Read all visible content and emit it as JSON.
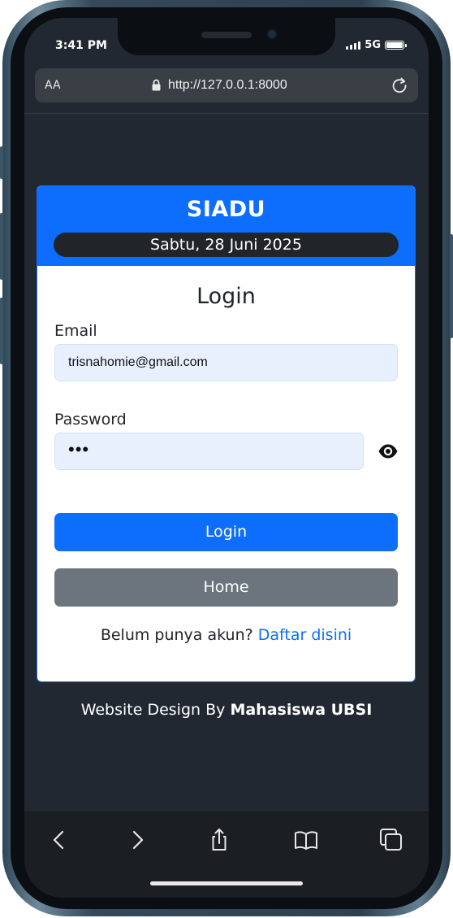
{
  "status_bar": {
    "time": "3:41 PM",
    "network": "5G",
    "battery_level": 1.0
  },
  "browser": {
    "text_size_label": "AA",
    "url": "http://127.0.0.1:8000"
  },
  "header": {
    "brand": "SIADU",
    "date": "Sabtu, 28 Juni 2025"
  },
  "login_form": {
    "title": "Login",
    "email_label": "Email",
    "email_value": "trisnahomie@gmail.com",
    "password_label": "Password",
    "password_value": "•••",
    "login_button": "Login",
    "home_button": "Home",
    "register_prompt": "Belum punya akun?",
    "register_link": "Daftar disini"
  },
  "footer": {
    "prefix": "Website Design By",
    "author": "Mahasiswa UBSI"
  },
  "toolbar": {
    "icons": [
      "back-icon",
      "forward-icon",
      "share-icon",
      "bookmarks-icon",
      "tabs-icon"
    ]
  },
  "colors": {
    "page_background": "#222831",
    "primary": "#0d6efd",
    "secondary": "#6c757d",
    "date_pill": "#212529",
    "input_background": "#e8f0fe"
  }
}
